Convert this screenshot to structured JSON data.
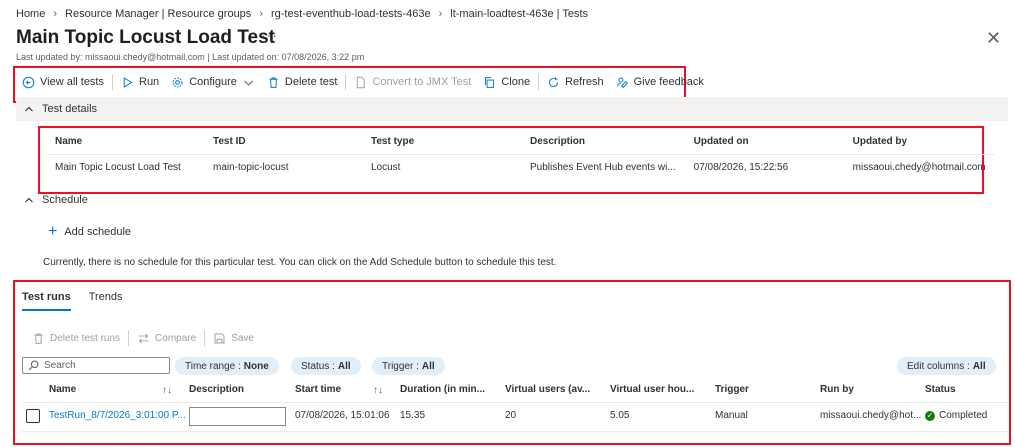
{
  "breadcrumb": [
    "Home",
    "Resource Manager | Resource groups",
    "rg-test-eventhub-load-tests-463e",
    "lt-main-loadtest-463e | Tests"
  ],
  "page": {
    "title": "Main Topic Locust Load Test",
    "more": "···",
    "subtitle": "Last updated by: missaoui.chedy@hotmail.com | Last updated on: 07/08/2026, 3:22 pm"
  },
  "toolbar": {
    "view_all": "View all tests",
    "run": "Run",
    "configure": "Configure",
    "delete": "Delete test",
    "convert": "Convert to JMX Test",
    "clone": "Clone",
    "refresh": "Refresh",
    "feedback": "Give feedback"
  },
  "details": {
    "section_label": "Test details",
    "headers": [
      "Name",
      "Test ID",
      "Test type",
      "Description",
      "Updated on",
      "Updated by"
    ],
    "row": [
      "Main Topic Locust Load Test",
      "main-topic-locust",
      "Locust",
      "Publishes Event Hub events wi...",
      "07/08/2026, 15:22:56",
      "missaoui.chedy@hotmail.com"
    ]
  },
  "schedule": {
    "section_label": "Schedule",
    "add_label": "Add schedule",
    "message": "Currently, there is no schedule for this particular test. You can click on the Add Schedule button to schedule this test."
  },
  "runs": {
    "tabs": [
      "Test runs",
      "Trends"
    ],
    "toolbar": {
      "delete": "Delete test runs",
      "compare": "Compare",
      "save": "Save"
    },
    "search_placeholder": "Search",
    "filters": {
      "time_range_label": "Time range :",
      "time_range_value": "None",
      "status_label": "Status :",
      "status_value": "All",
      "trigger_label": "Trigger :",
      "trigger_value": "All",
      "edit_columns_label": "Edit columns :",
      "edit_columns_value": "All"
    },
    "headers": [
      "Name",
      "Description",
      "Start time",
      "Duration (in min...",
      "Virtual users (av...",
      "Virtual user hou...",
      "Trigger",
      "Run by",
      "Status"
    ],
    "row": {
      "name": "TestRun_8/7/2026_3:01:00 P...",
      "start_time": "07/08/2026, 15:01:06",
      "duration": "15.35",
      "virtual_users": "20",
      "virtual_user_hours": "5.05",
      "trigger": "Manual",
      "run_by": "missaoui.chedy@hot...",
      "status": "Completed"
    }
  },
  "colors": {
    "accent": "#0078d4",
    "highlight_box": "#e81123",
    "success": "#107c10"
  }
}
